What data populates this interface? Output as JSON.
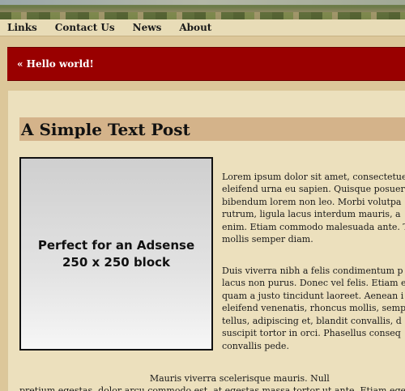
{
  "nav": {
    "items": [
      "Links",
      "Contact Us",
      "News",
      "About"
    ]
  },
  "prev_post": {
    "label": "« Hello world!"
  },
  "post": {
    "title": "A Simple Text Post",
    "ad": {
      "line1": "Perfect for an Adsense",
      "line2": "250 x 250 block"
    },
    "para1_lines": [
      "Lorem ipsum dolor sit amet, consectetue",
      "eleifend urna eu sapien. Quisque posuere",
      "bibendum lorem non leo. Morbi volutpa",
      "rutrum, ligula lacus interdum mauris, a",
      "enim. Etiam commodo malesuada ante. T",
      "mollis semper diam."
    ],
    "para2_lines": [
      "Duis viverra nibh a felis condimentum p",
      "lacus non purus. Donec vel felis. Etiam e",
      "quam a justo tincidunt laoreet. Aenean i",
      "eleifend venenatis, rhoncus mollis, semp",
      "tellus, adipiscing et, blandit convallis, d",
      "suscipit tortor in orci. Phasellus conseq",
      "convallis pede."
    ],
    "para3_lines": [
      "                                              Mauris viverra scelerisque mauris. Null",
      "pretium egestas, dolor arcu commodo est, at egestas massa tortor ut ante. Etiam eget"
    ]
  },
  "colors": {
    "accent_red": "#990000",
    "title_band": "#d4b38a",
    "page_bg": "#dcc79a"
  }
}
